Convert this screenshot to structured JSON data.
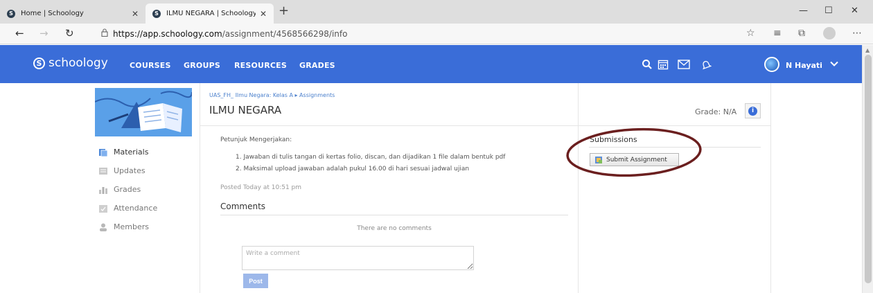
{
  "browser": {
    "tabs": [
      {
        "title": "Home | Schoology",
        "active": false
      },
      {
        "title": "ILMU NEGARA | Schoology",
        "active": true
      }
    ],
    "new_tab": "+",
    "url_domain": "https://app.schoology.com",
    "url_path": "/assignment/4568566298/info"
  },
  "header": {
    "logo": "schoology",
    "nav": [
      "COURSES",
      "GROUPS",
      "RESOURCES",
      "GRADES"
    ],
    "user_name": "N Hayati",
    "color": "#3a6dd8"
  },
  "left_nav": {
    "items": [
      {
        "label": "Materials",
        "icon": "materials-icon"
      },
      {
        "label": "Updates",
        "icon": "updates-icon"
      },
      {
        "label": "Grades",
        "icon": "grades-icon"
      },
      {
        "label": "Attendance",
        "icon": "attendance-icon"
      },
      {
        "label": "Members",
        "icon": "members-icon"
      }
    ]
  },
  "main": {
    "breadcrumb": "UAS_FH_ Ilmu Negara: Kelas A ▸ Assignments",
    "title": "ILMU NEGARA",
    "grade": "Grade:  N/A",
    "instructions_label": "Petunjuk Mengerjakan:",
    "instructions": [
      "1. Jawaban di tulis tangan di kertas folio, discan, dan dijadikan 1 file dalam bentuk pdf",
      "2. Maksimal upload jawaban adalah pukul 16.00 di hari sesuai jadwal ujian"
    ],
    "posted": "Posted Today at 10:51 pm",
    "comments_heading": "Comments",
    "no_comments": "There are no comments",
    "comment_placeholder": "Write a comment",
    "post_label": "Post"
  },
  "submissions": {
    "heading": "Submissions",
    "submit_label": "Submit Assignment",
    "annotation_color": "#6b1f1f"
  }
}
